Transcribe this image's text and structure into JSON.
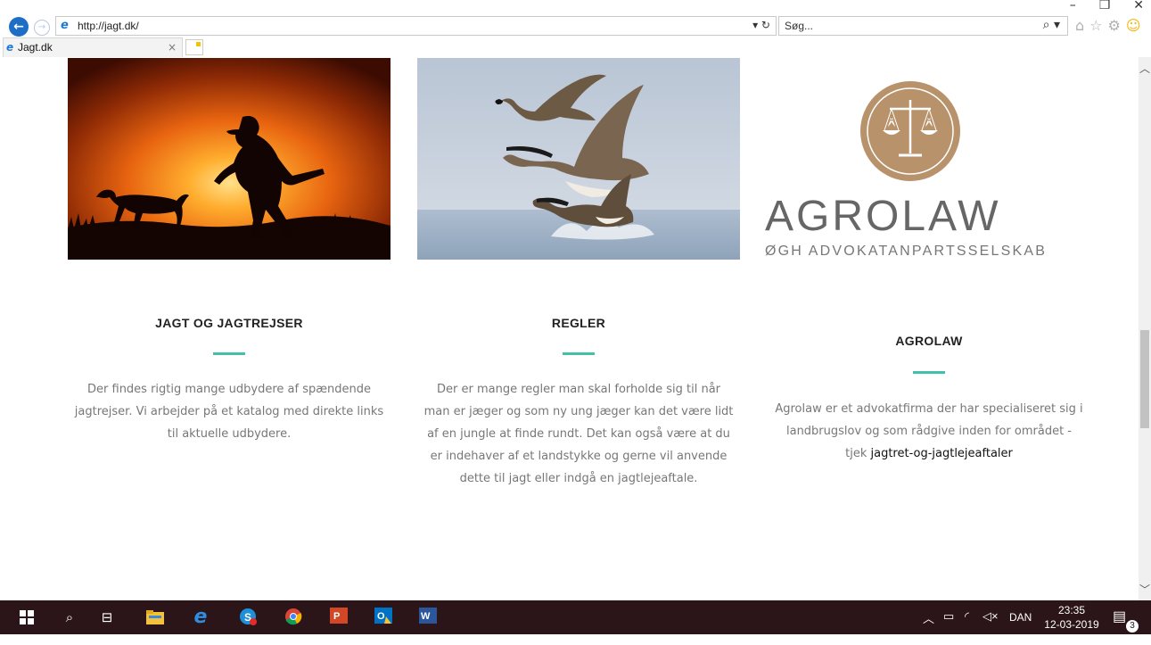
{
  "browser": {
    "url": "http://jagt.dk/",
    "search_placeholder": "Søg...",
    "tab_title": "Jagt.dk",
    "tab_close": "×",
    "addr_controls": "▾ ↻",
    "search_controls": "⌕ ▾",
    "icons": [
      "home-icon",
      "favorites-star-icon",
      "settings-gear-icon",
      "feedback-smiley-icon"
    ]
  },
  "logo": {
    "brand": "AGROLAW",
    "tagline": "ØGH ADVOKATANPARTSSELSKAB",
    "accent": "#b8926b"
  },
  "columns": [
    {
      "title": "JAGT OG JAGTREJSER",
      "lines": [
        "Der findes rigtig mange udbydere af spændende",
        "jagtrejser. Vi arbejder på et katalog med direkte links",
        "til aktuelle udbydere."
      ]
    },
    {
      "title": "REGLER",
      "lines": [
        "Der er mange regler man skal forholde sig til når",
        "man er jæger og som ny ung jæger kan det være lidt",
        "af en jungle at finde rundt. Det kan også være at du",
        "er indehaver af et landstykke og gerne vil anvende",
        "dette til jagt eller indgå en jagtlejeaftale."
      ]
    },
    {
      "title": "AGROLAW",
      "lines": [
        "Agrolaw er et advokatfirma der har specialiseret sig i",
        "landbrugslov og som rådgive inden for området -"
      ],
      "link_prefix": "tjek ",
      "link_text": "jagtret-og-jagtlejeaftaler"
    }
  ],
  "colors": {
    "accent_bar": "#3fc1aa",
    "body_text": "#777777",
    "taskbar": "#2b1518"
  },
  "taskbar": {
    "language": "DAN",
    "time": "23:35",
    "date": "12-03-2019",
    "notification_count": "3",
    "apps": [
      "start-icon",
      "search-icon",
      "task-view-icon",
      "file-explorer-icon",
      "internet-explorer-icon",
      "skype-icon",
      "chrome-icon",
      "powerpoint-icon",
      "outlook-icon",
      "word-icon"
    ]
  }
}
